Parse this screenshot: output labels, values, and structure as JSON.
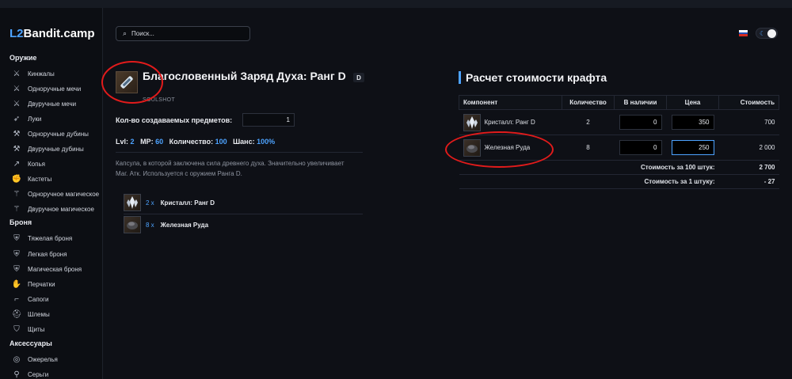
{
  "site": {
    "logo_prefix": "L2",
    "logo_suffix": "Bandit.camp"
  },
  "search": {
    "placeholder": "Поиск..."
  },
  "header": {
    "locale_flag_colors": [
      "#ffffff",
      "#1f4fb8",
      "#d52b1e"
    ],
    "theme_icon": "moon-icon"
  },
  "sidebar": {
    "categories": [
      {
        "label": "Оружие",
        "items": [
          {
            "label": "Кинжалы",
            "icon": "dagger-icon"
          },
          {
            "label": "Одноручные мечи",
            "icon": "sword-icon"
          },
          {
            "label": "Двуручные мечи",
            "icon": "two-handed-sword-icon"
          },
          {
            "label": "Луки",
            "icon": "bow-icon"
          },
          {
            "label": "Одноручные дубины",
            "icon": "blunt-icon"
          },
          {
            "label": "Двуручные дубины",
            "icon": "two-handed-blunt-icon"
          },
          {
            "label": "Копья",
            "icon": "spear-icon"
          },
          {
            "label": "Кастеты",
            "icon": "fist-icon"
          },
          {
            "label": "Одноручное магическое",
            "icon": "wand-icon"
          },
          {
            "label": "Двуручное магическое",
            "icon": "staff-icon"
          }
        ]
      },
      {
        "label": "Броня",
        "items": [
          {
            "label": "Тяжелая броня",
            "icon": "heavy-armor-icon"
          },
          {
            "label": "Легкая броня",
            "icon": "light-armor-icon"
          },
          {
            "label": "Магическая броня",
            "icon": "robe-icon"
          },
          {
            "label": "Перчатки",
            "icon": "gloves-icon"
          },
          {
            "label": "Сапоги",
            "icon": "boots-icon"
          },
          {
            "label": "Шлемы",
            "icon": "helmet-icon"
          },
          {
            "label": "Щиты",
            "icon": "shield-icon"
          }
        ]
      },
      {
        "label": "Аксессуары",
        "items": [
          {
            "label": "Ожерелья",
            "icon": "necklace-icon"
          },
          {
            "label": "Серьги",
            "icon": "earring-icon"
          }
        ]
      }
    ]
  },
  "item": {
    "title": "Благословенный Заряд Духа: Ранг D",
    "grade": "D",
    "type": "SOULSHOT",
    "qty_label": "Кол-во создаваемых предметов:",
    "qty_value": "1",
    "stats": {
      "lvl_label": "Lvl:",
      "lvl": "2",
      "mp_label": "MP:",
      "mp": "60",
      "count_label": "Количество:",
      "count": "100",
      "chance_label": "Шанс:",
      "chance": "100%"
    },
    "description": "Капсула, в которой заключена сила древнего духа. Значительно увеличивает Маг. Атк. Используется с оружием Ранга D.",
    "materials": [
      {
        "count": "2 x",
        "name": "Кристалл: Ранг D",
        "icon": "crystal-icon"
      },
      {
        "count": "8 x",
        "name": "Железная Руда",
        "icon": "iron-ore-icon"
      }
    ]
  },
  "calc": {
    "title": "Расчет стоимости крафта",
    "headers": [
      "Компонент",
      "Количество",
      "В наличии",
      "Цена",
      "Стоимость"
    ],
    "rows": [
      {
        "name": "Кристалл: Ранг D",
        "icon": "crystal-icon",
        "qty": "2",
        "have": "0",
        "price": "350",
        "cost": "700"
      },
      {
        "name": "Железная Руда",
        "icon": "iron-ore-icon",
        "qty": "8",
        "have": "0",
        "price": "250",
        "cost": "2 000"
      }
    ],
    "total_label": "Стоимость за 100 штук:",
    "total": "2 700",
    "per_unit_label": "Стоимость за 1 штуку:",
    "per_unit": "- 27"
  },
  "colors": {
    "accent": "#4da3ff",
    "annotation": "#e21b1b"
  }
}
